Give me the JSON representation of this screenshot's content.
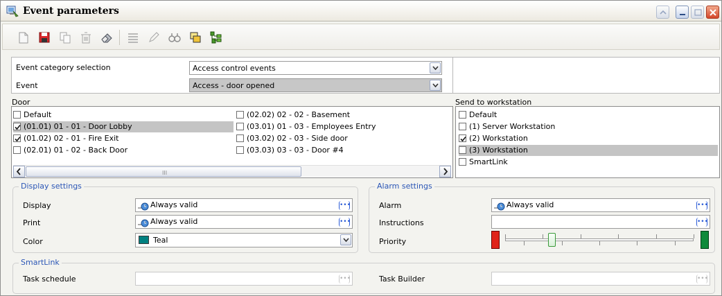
{
  "window": {
    "title": "Event parameters"
  },
  "toolbar": {
    "buttons": [
      "new-icon",
      "save-icon",
      "copy-icon",
      "delete-icon",
      "eraser-icon",
      "list-icon",
      "edit-icon",
      "find-icon",
      "windows-icon",
      "tree-icon"
    ]
  },
  "selection": {
    "category_label": "Event category selection",
    "category_value": "Access control events",
    "event_label": "Event",
    "event_value": "Access - door opened"
  },
  "door": {
    "label": "Door",
    "col1": [
      {
        "text": "Default",
        "checked": false,
        "highlighted": false
      },
      {
        "text": "(01.01) 01 - 01 - Door Lobby",
        "checked": true,
        "highlighted": true
      },
      {
        "text": "(01.02) 02 - 01 - Fire Exit",
        "checked": true,
        "highlighted": false
      },
      {
        "text": "(02.01) 01 - 02 - Back Door",
        "checked": false,
        "highlighted": false
      }
    ],
    "col2": [
      {
        "text": "(02.02) 02 - 02 - Basement",
        "checked": false,
        "highlighted": false
      },
      {
        "text": "(03.01) 01 - 03 - Employees Entry",
        "checked": false,
        "highlighted": false
      },
      {
        "text": "(03.02) 02 - 03 - Side door",
        "checked": false,
        "highlighted": false
      },
      {
        "text": "(03.03) 03 - 03 - Door #4",
        "checked": false,
        "highlighted": false
      }
    ]
  },
  "workstation": {
    "label": "Send to workstation",
    "items": [
      {
        "text": "Default",
        "checked": false,
        "highlighted": false
      },
      {
        "text": "(1) Server Workstation",
        "checked": false,
        "highlighted": false
      },
      {
        "text": "(2) Workstation",
        "checked": true,
        "highlighted": false
      },
      {
        "text": "(3) Workstation",
        "checked": false,
        "highlighted": true
      },
      {
        "text": "SmartLink",
        "checked": false,
        "highlighted": false
      }
    ]
  },
  "display_settings": {
    "title": "Display settings",
    "display_label": "Display",
    "display_value": "Always valid",
    "print_label": "Print",
    "print_value": "Always valid",
    "color_label": "Color",
    "color_value": "Teal",
    "color_hex": "#008080"
  },
  "alarm_settings": {
    "title": "Alarm settings",
    "alarm_label": "Alarm",
    "alarm_value": "Always valid",
    "instructions_label": "Instructions",
    "instructions_value": "",
    "priority_label": "Priority",
    "priority_level": 0.25,
    "low_color": "#e0231a",
    "high_color": "#0f8a3a"
  },
  "smartlink": {
    "title": "SmartLink",
    "task_schedule_label": "Task schedule",
    "task_builder_label": "Task Builder"
  },
  "misc": {
    "ellipsis": "•••",
    "grip": "III"
  }
}
